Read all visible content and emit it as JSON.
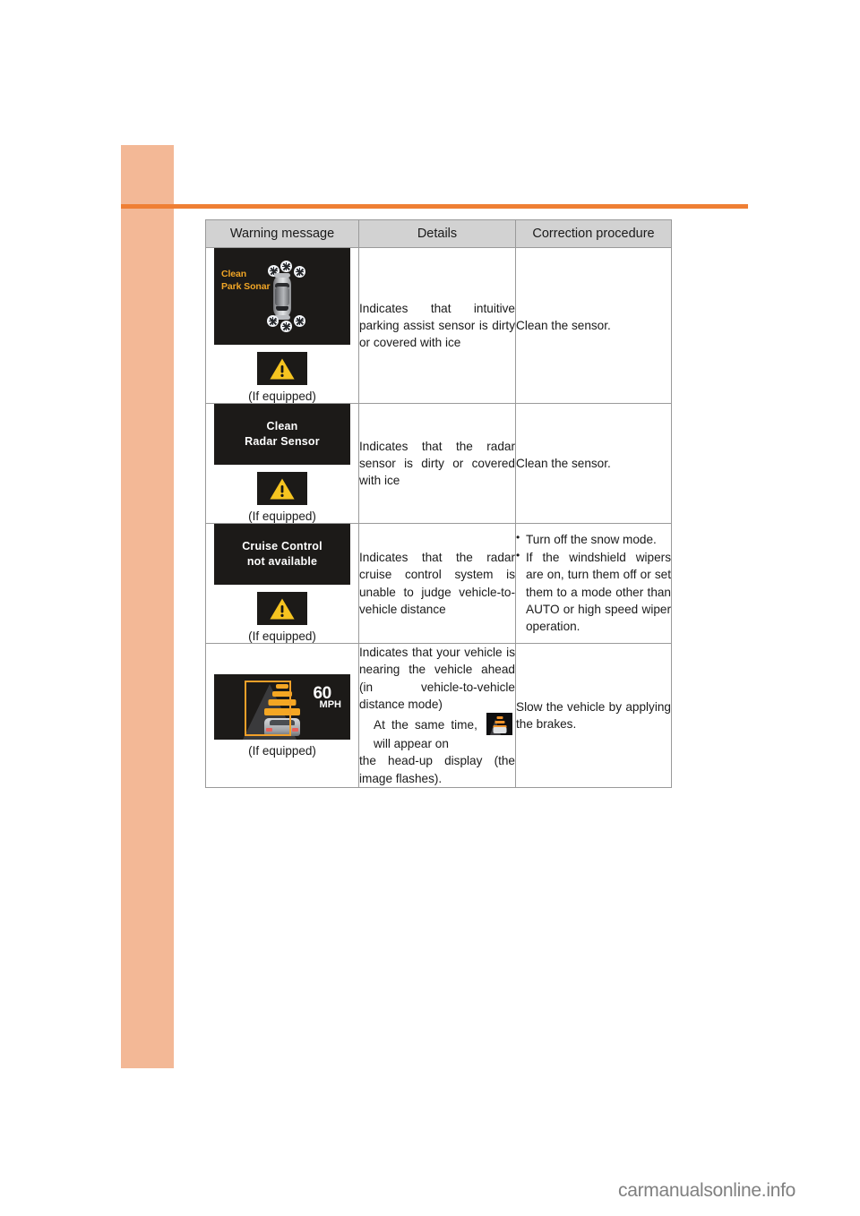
{
  "page": {
    "watermark": "carmanualsonline.info",
    "accent_color": "#ef7f34",
    "sidebar_color": "#f3b896",
    "header_bg": "#d2d2d2",
    "display_bg": "#1c1a18",
    "warning_yellow": "#f6c420",
    "hud_orange": "#f4a623"
  },
  "table": {
    "headers": {
      "col1": "Warning message",
      "col2": "Details",
      "col3": "Correction procedure"
    },
    "rows": [
      {
        "id": "clean-park-sonar",
        "display_type": "sonar-diagram",
        "display_text_line1": "Clean",
        "display_text_line2": "Park Sonar",
        "icon": "warning-triangle-icon",
        "note": "(If equipped)",
        "details": "Indicates that intuitive parking assist sensor is dirty or covered with ice",
        "procedure": "Clean the sensor."
      },
      {
        "id": "clean-radar-sensor",
        "display_type": "text-panel",
        "display_text_line1": "Clean",
        "display_text_line2": "Radar Sensor",
        "icon": "warning-triangle-icon",
        "note": "(If equipped)",
        "details": "Indicates that the radar sensor is dirty or covered with ice",
        "procedure": "Clean the sensor."
      },
      {
        "id": "cruise-control-not-available",
        "display_type": "text-panel",
        "display_text_line1": "Cruise Control",
        "display_text_line2": "not available",
        "icon": "warning-triangle-icon",
        "note": "(If equipped)",
        "details": "Indicates that the radar cruise control system is unable to judge vehicle-to-vehicle distance",
        "procedure_bullets": [
          "Turn off the snow mode.",
          "If the windshield wipers are on, turn them off or set them to a mode other than AUTO or high speed wiper operation."
        ]
      },
      {
        "id": "vehicle-ahead-warning",
        "display_type": "hud-panel",
        "hud_speed_value": "60",
        "hud_speed_unit": "MPH",
        "note": "(If equipped)",
        "details_part1": "Indicates that your vehicle is nearing the vehicle ahead (in vehicle-to-vehicle distance mode)",
        "details_part2": "At the same time,",
        "details_inline_icon": "hud-vehicle-ahead-icon",
        "details_part3": "will appear on",
        "details_part4": "the head-up display (the image flashes).",
        "procedure": "Slow the vehicle by applying the brakes."
      }
    ]
  }
}
